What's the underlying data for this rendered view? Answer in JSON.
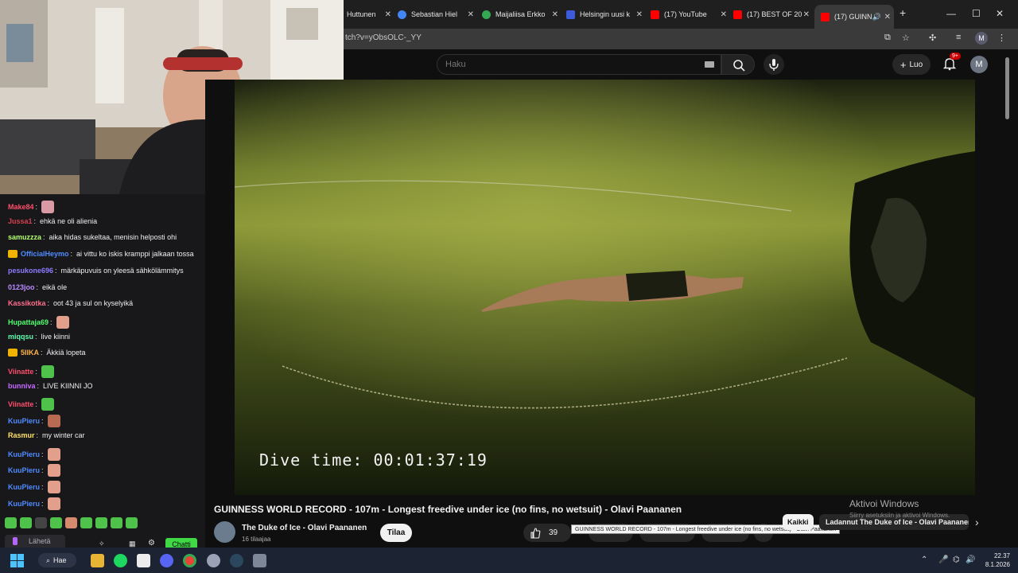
{
  "browser": {
    "tabs": [
      {
        "title": "Huttunen",
        "favicon_color": "#ffffff"
      },
      {
        "title": "Sebastian Hiel",
        "favicon_color": "#4285f4"
      },
      {
        "title": "Maijaliisa Erkko",
        "favicon_color": "#34a853"
      },
      {
        "title": "Helsingin uusi k",
        "favicon_color": "#3b5bdb"
      },
      {
        "title": "(17) YouTube",
        "favicon_color": "#ff0000"
      },
      {
        "title": "(17) BEST OF 20",
        "favicon_color": "#ff0000"
      },
      {
        "title": "(17) GUINN",
        "favicon_color": "#ff0000"
      }
    ],
    "url": "tch?v=yObsOLC-_YY",
    "profile_initial": "M"
  },
  "youtube": {
    "search_placeholder": "Haku",
    "create_label": "Luo",
    "notification_count": "9+",
    "avatar_initial": "M"
  },
  "chat": {
    "messages": [
      {
        "user": "Make84",
        "color": "#ff4d6a",
        "text": "",
        "emote_color": "#d99aa5"
      },
      {
        "user": "Jussa1",
        "color": "#d64050",
        "text": "ehkä ne oli alienia"
      },
      {
        "user": "samuzzza",
        "color": "#b4ff6e",
        "text": "aika hidas sukeltaa, menisin helposti ohi"
      },
      {
        "user": "OfficialHeymo",
        "color": "#4f8bff",
        "text": "ai vittu ko iskis kramppi jalkaan tossa",
        "badge": true
      },
      {
        "user": "pesukone696",
        "color": "#8c7cff",
        "text": "märkäpuvuis on yleesä sähkölämmitys"
      },
      {
        "user": "0123joo",
        "color": "#b98cff",
        "text": "eikä ole"
      },
      {
        "user": "Kassikotka",
        "color": "#ff6e8c",
        "text": "oot 43 ja sul on kyselyikä"
      },
      {
        "user": "Hupattaja69",
        "color": "#4fff6e",
        "text": "",
        "emote_color": "#e2a08c"
      },
      {
        "user": "miqqsu",
        "color": "#5cffb0",
        "text": "live kiinni"
      },
      {
        "user": "5IIKA",
        "color": "#ffb347",
        "text": "Äkkiä lopeta",
        "badge": true
      },
      {
        "user": "Viinatte",
        "color": "#ff4d6a",
        "text": "",
        "emote_color": "#4ec24a"
      },
      {
        "user": "bunniva",
        "color": "#c46bff",
        "text": "LIVE KIINNI JO"
      },
      {
        "user": "Viinatte",
        "color": "#ff4d6a",
        "text": "",
        "emote_color": "#4ec24a"
      },
      {
        "user": "KuuPieru",
        "color": "#4f8bff",
        "text": "",
        "emote_color": "#b86b52"
      },
      {
        "user": "Rasmur",
        "color": "#ffe066",
        "text": "my winter car"
      },
      {
        "user": "KuuPieru",
        "color": "#4f8bff",
        "text": "",
        "emote_color": "#e2a08c"
      },
      {
        "user": "KuuPieru",
        "color": "#4f8bff",
        "text": "",
        "emote_color": "#e2a08c"
      },
      {
        "user": "KuuPieru",
        "color": "#4f8bff",
        "text": "",
        "emote_color": "#e2a08c"
      },
      {
        "user": "KuuPieru",
        "color": "#4f8bff",
        "text": "",
        "emote_color": "#e2a08c"
      }
    ],
    "input_placeholder": "Lähetä",
    "send_label": "Chatti"
  },
  "video": {
    "overlay_text": "Dive time: 00:01:37:19",
    "title": "GUINNESS WORLD RECORD - 107m - Longest freedive under ice (no fins, no wetsuit) - Olavi Paananen",
    "channel": "The Duke of Ice - Olavi Paananen",
    "subscribers": "16 tilaajaa",
    "subscribe_label": "Tilaa",
    "likes": "39",
    "tooltip": "GUINNESS WORLD RECORD - 107m - Longest freedive under ice (no fins, no wetsuit) - Olavi Paananen"
  },
  "chips": {
    "all": "Kaikki",
    "uploaded": "Ladannut The Duke of Ice - Olavi Paananen"
  },
  "watermark": {
    "title": "Aktivoi Windows",
    "subtitle": "Siirry asetuksiin ja aktivoi Windows."
  },
  "taskbar": {
    "search_label": "Hae",
    "time": "22.37",
    "date": "8.1.2026"
  }
}
